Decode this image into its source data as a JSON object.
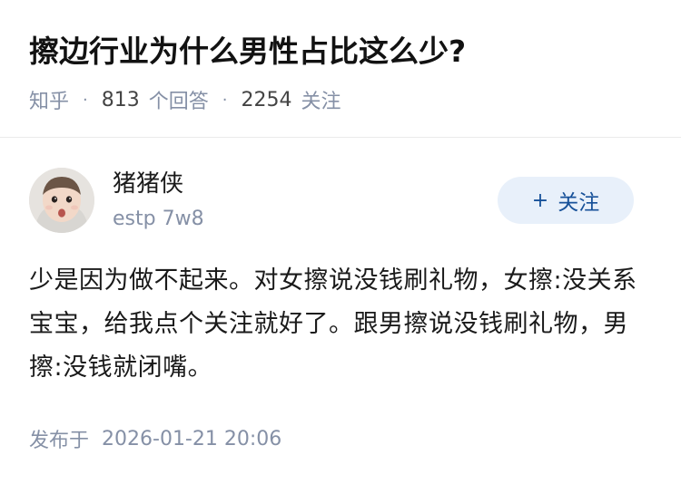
{
  "question": {
    "title": "擦边行业为什么男性占比这么少?",
    "source": "知乎",
    "answer_count": "813",
    "answer_label": "个回答",
    "follower_count": "2254",
    "follower_label": "关注",
    "meta_separator": "·"
  },
  "author": {
    "name": "猪猪侠",
    "bio": "estp 7w8",
    "follow_plus": "+",
    "follow_label": "关注"
  },
  "answer": {
    "content": "少是因为做不起来。对女擦说没钱刷礼物，女擦:没关系宝宝，给我点个关注就好了。跟男擦说没钱刷礼物，男擦:没钱就闭嘴。",
    "published_label": "发布于",
    "published_time": "2026-01-21 20:06"
  },
  "colors": {
    "title": "#121212",
    "meta": "#8590a6",
    "follow_bg": "#e8f0fa",
    "follow_text": "#175199"
  }
}
